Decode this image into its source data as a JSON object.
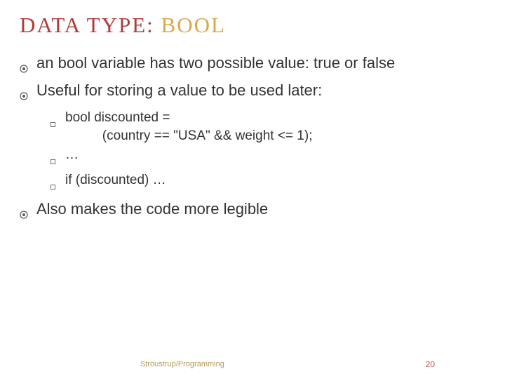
{
  "title": {
    "red_part": "DATA TYPE:",
    "sep": " ",
    "yellow_part": "BOOL"
  },
  "bullets": {
    "b1": "an bool variable has two possible value: true or false",
    "b2": "Useful for storing a value to be used later:",
    "b3": "Also makes the code more legible"
  },
  "sub": {
    "s1": "bool discounted =\n          (country == \"USA\" && weight <= 1);",
    "s2": "…",
    "s3": "if (discounted) …"
  },
  "footer": {
    "text": "Stroustrup/Programming",
    "page": "20"
  }
}
